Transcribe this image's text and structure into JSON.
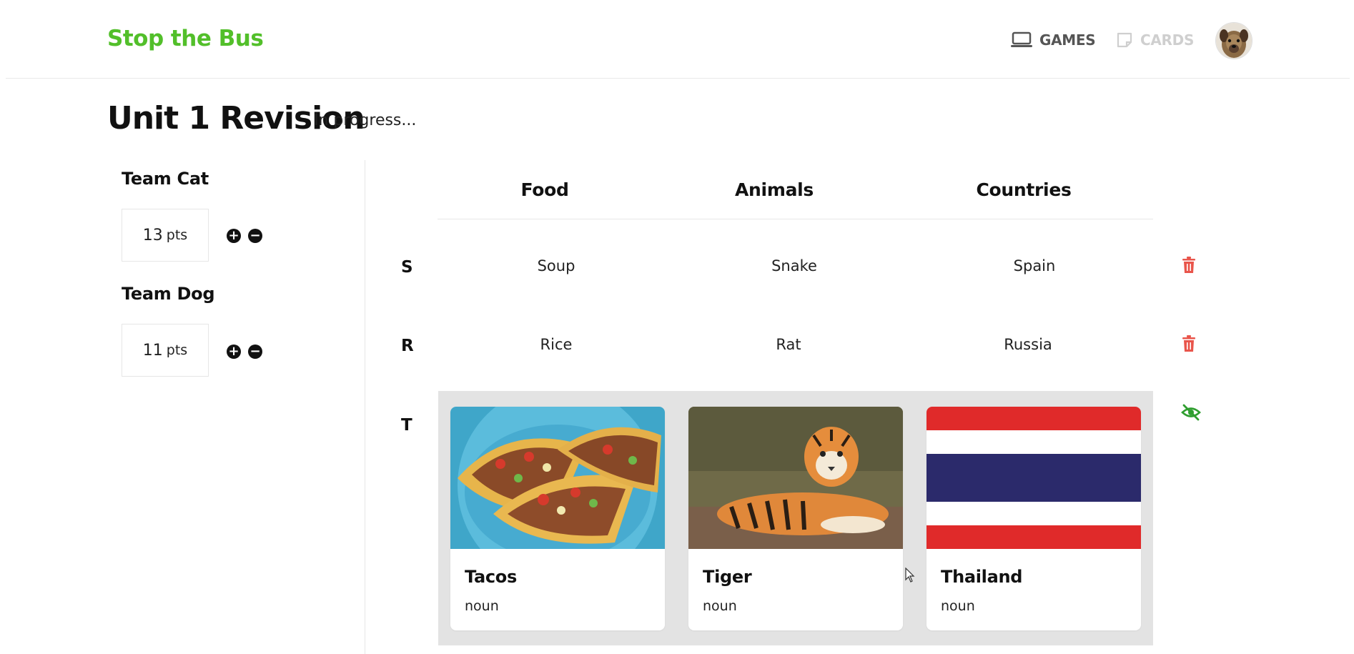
{
  "header": {
    "brand": "Stop the Bus",
    "nav": {
      "games": "GAMES",
      "cards": "CARDS"
    },
    "avatar_icon": "dog-avatar-icon"
  },
  "page": {
    "title": "Unit 1 Revision",
    "status": "In progress..."
  },
  "teams": [
    {
      "name": "Team Cat",
      "score": "13",
      "unit": "pts"
    },
    {
      "name": "Team Dog",
      "score": "11",
      "unit": "pts"
    }
  ],
  "board": {
    "columns": [
      "Food",
      "Animals",
      "Countries"
    ],
    "rows": [
      {
        "letter": "S",
        "cells": [
          "Soup",
          "Snake",
          "Spain"
        ]
      },
      {
        "letter": "R",
        "cells": [
          "Rice",
          "Rat",
          "Russia"
        ]
      },
      {
        "letter": "T",
        "cells": [
          {
            "word": "Tacos",
            "pos": "noun",
            "image": "tacos-image"
          },
          {
            "word": "Tiger",
            "pos": "noun",
            "image": "tiger-image"
          },
          {
            "word": "Thailand",
            "pos": "noun",
            "image": "thailand-flag-image"
          }
        ]
      }
    ]
  },
  "colors": {
    "brand": "#52bf2a",
    "delete": "#e9554b",
    "reveal": "#2f9e2f",
    "panel": "#e3e3e3"
  }
}
